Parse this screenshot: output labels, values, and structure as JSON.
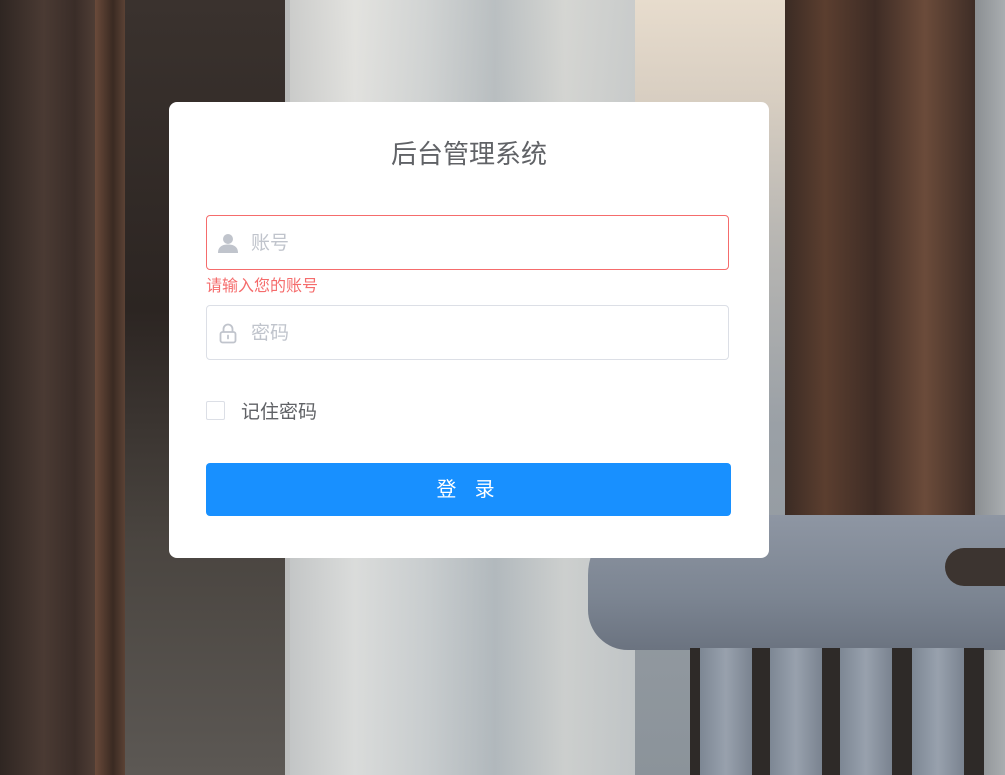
{
  "login": {
    "title": "后台管理系统",
    "account": {
      "placeholder": "账号",
      "value": "",
      "error": "请输入您的账号"
    },
    "password": {
      "placeholder": "密码",
      "value": ""
    },
    "remember_label": "记住密码",
    "remember_checked": false,
    "submit_label": "登 录"
  },
  "colors": {
    "primary": "#1890ff",
    "error": "#f56c6c",
    "text": "#606266",
    "placeholder": "#c0c4cc",
    "border": "#dcdfe6"
  },
  "icons": {
    "account": "user-icon",
    "password": "lock-icon"
  }
}
